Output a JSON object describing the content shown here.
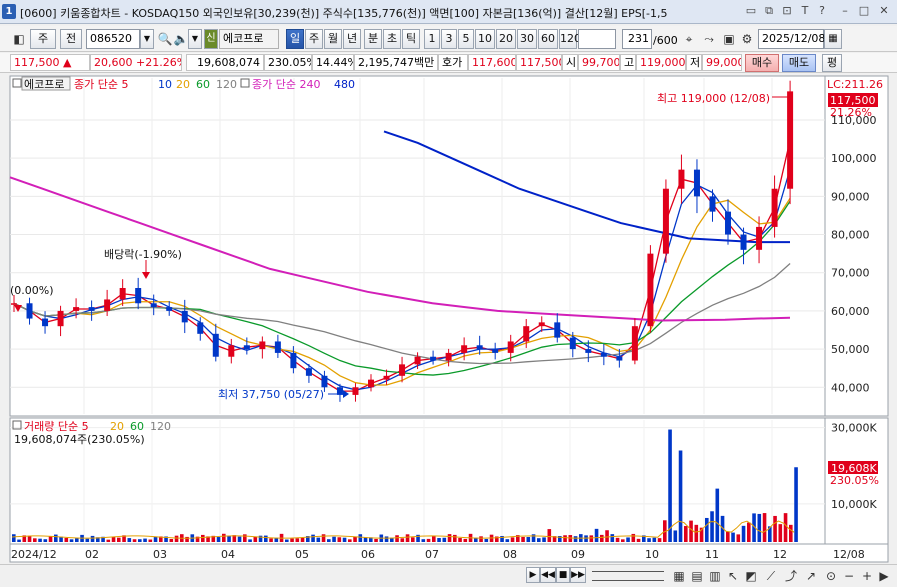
{
  "window": {
    "app_number": "1",
    "title": "[0600] 키움종합차트 - KOSDAQ150 외국인보유[30,239(천)] 주식수[135,776(천)] 액면[100] 자본금[136(억)] 결산[12월] EPS[-1,5"
  },
  "toolbar": {
    "mode_label": "주",
    "prev_label": "전",
    "code": "086520",
    "stock_name": "에코프로",
    "stock_badge": "신",
    "periods": [
      "일",
      "주",
      "월",
      "년",
      "분",
      "초",
      "틱"
    ],
    "active_period": "일",
    "intervals": [
      "1",
      "3",
      "5",
      "10",
      "20",
      "30",
      "60",
      "120"
    ],
    "count": "231",
    "count_total": "/600",
    "date": "2025/12/08"
  },
  "quote": {
    "price": "117,500",
    "change": "20,600",
    "change_pct": "+21.26%",
    "volume": "19,608,074",
    "volume_pct": "230.05%",
    "turnover_pct": "14.44%",
    "amount": "2,195,747백만",
    "ask_label": "호가",
    "ask": "117,600",
    "bid": "117,500",
    "open_label": "시",
    "open": "99,700",
    "high_label": "고",
    "high": "119,000",
    "low_label": "저",
    "low": "99,000",
    "buy_label": "매수",
    "sell_label": "매도",
    "avg_label": "평"
  },
  "legend_main": {
    "name": "에코프로",
    "ma1_label": "종가 단순 5",
    "ma_periods": [
      "10",
      "20",
      "60",
      "120"
    ],
    "ma2_label": "종가 단순 240",
    "ma2_extra": "480"
  },
  "legend_vol": {
    "label": "거래량 단순 5",
    "periods": [
      "20",
      "60",
      "120"
    ],
    "value": "19,608,074주(230.05%)"
  },
  "annotations": {
    "lc": "LC:211.26",
    "last_price": "117,500",
    "last_pct": "21.26%",
    "high_note": "최고 119,000 (12/08)",
    "low_note": "최저 37,750 (05/27)",
    "dividend_note": "배당락(-1.90%)",
    "left_note": "(0.00%)",
    "vol_last": "19,608K",
    "vol_pct": "230.05%"
  },
  "colors": {
    "up": "#e0001b",
    "down": "#0037c8",
    "ma5": "#e0001b",
    "ma10": "#0037c8",
    "ma20": "#e3a000",
    "ma60": "#0a9a2a",
    "ma120": "#808080",
    "ma240": "#d21fb8",
    "ma480": "#0022c8"
  },
  "chart_data": {
    "type": "candlestick",
    "x_ticks": [
      "2024/12",
      "02",
      "03",
      "04",
      "05",
      "06",
      "07",
      "08",
      "09",
      "10",
      "11",
      "12",
      "12/08"
    ],
    "y_ticks_price": [
      "110,000",
      "100,000",
      "90,000",
      "80,000",
      "70,000",
      "60,000",
      "50,000",
      "40,000"
    ],
    "y_ticks_volume": [
      "30,000K",
      "10,000K"
    ],
    "price_ylim": [
      33000,
      121000
    ],
    "volume_ylim": [
      0,
      32000
    ],
    "series_close": [
      62000,
      58000,
      56000,
      60000,
      61000,
      60000,
      63000,
      66000,
      62000,
      61000,
      60000,
      57000,
      54000,
      48000,
      51000,
      50000,
      52000,
      49000,
      45000,
      43000,
      40000,
      38000,
      40000,
      42000,
      43000,
      46000,
      48000,
      47000,
      49000,
      51000,
      50000,
      49000,
      52000,
      56000,
      57000,
      53000,
      50000,
      49000,
      48000,
      47000,
      56000,
      75000,
      92000,
      97000,
      90000,
      86000,
      80000,
      76000,
      82000,
      92000,
      117500
    ],
    "series_ma240": [
      95000,
      92000,
      89000,
      86000,
      83000,
      80000,
      77000,
      74000,
      71000,
      69000,
      67000,
      65000,
      63500,
      62000,
      61000,
      60000,
      59500,
      59000,
      58500,
      58000,
      57500,
      57600,
      57700,
      58000,
      58200
    ],
    "series_ma480": [
      107000,
      104000,
      100000,
      96000,
      92000,
      89000,
      86000,
      83000,
      81000,
      79000,
      78500,
      78000,
      78000
    ],
    "volume_peaks": {
      "2025-10-13": 29500,
      "2025-10-17": 24000,
      "2025-11-03": 14000,
      "2025-12-08": 19608
    }
  }
}
